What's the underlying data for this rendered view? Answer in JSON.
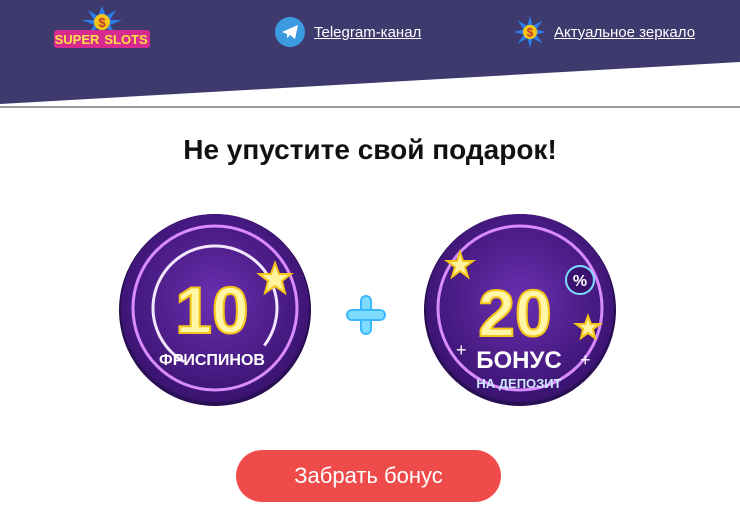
{
  "header": {
    "logo_word1": "SUPER",
    "logo_word2": "SLOTS",
    "telegram_label": "Telegram-канал",
    "mirror_label": "Актуальное зеркало",
    "bg_color": "#3f3a6e"
  },
  "main": {
    "title": "Не упустите свой подарок!",
    "gift1": {
      "number": "10",
      "caption": "ФРИСПИНОВ"
    },
    "gift2": {
      "number": "20",
      "percent": "%",
      "caption": "БОНУС",
      "sub": "НА ДЕПОЗИТ"
    },
    "cta_label": "Забрать бонус",
    "cta_color": "#ef4b4b"
  },
  "icons": [
    "telegram-icon",
    "dollar-star-icon",
    "plus-icon",
    "star-icon"
  ]
}
